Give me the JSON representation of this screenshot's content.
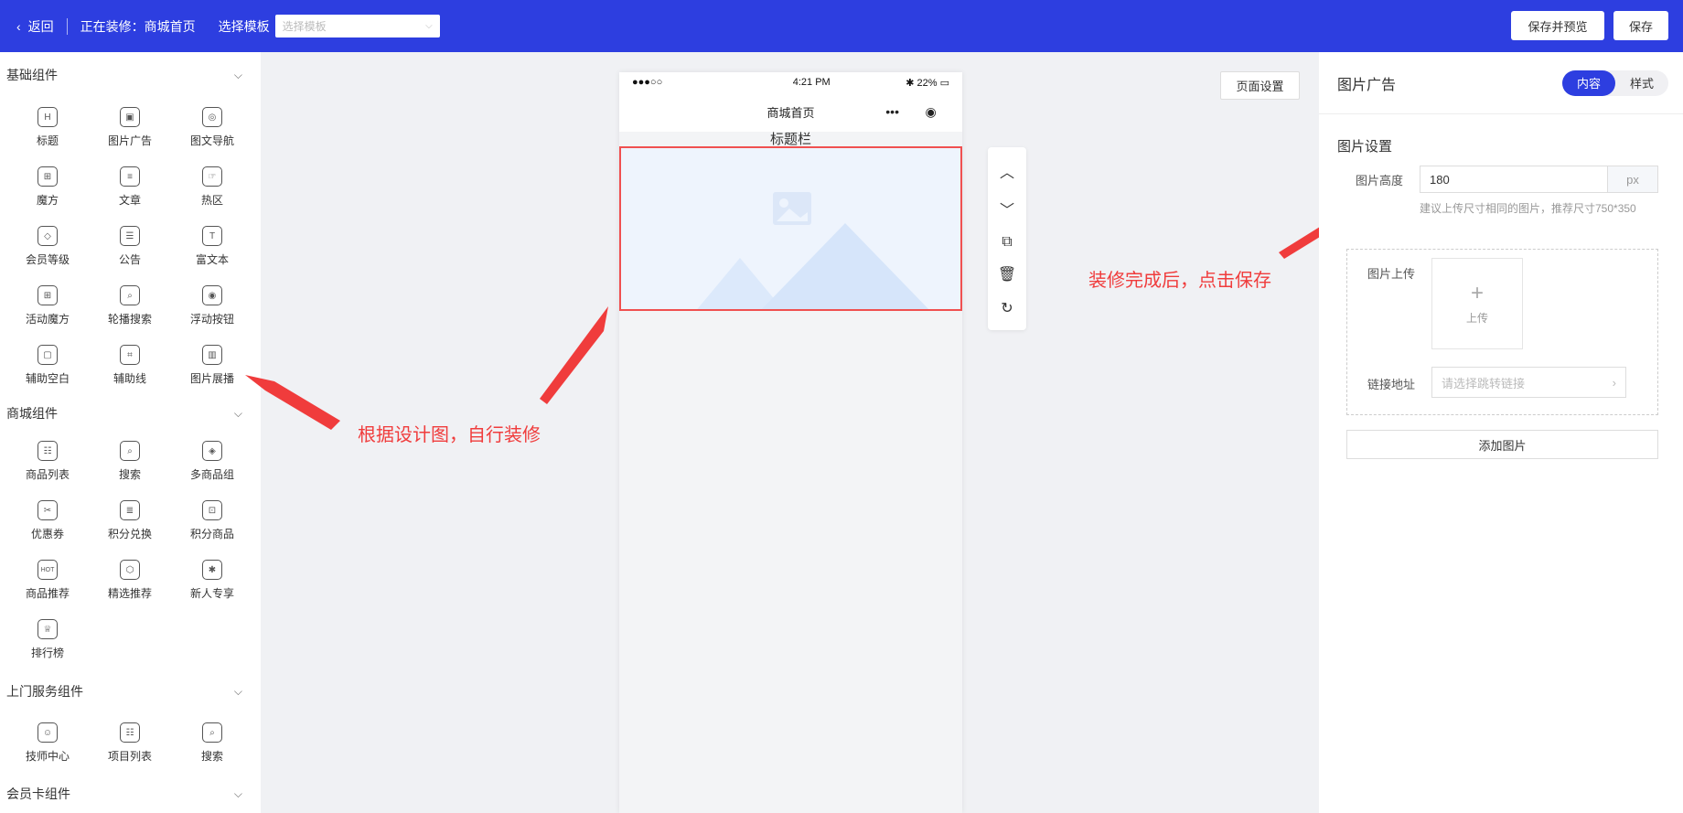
{
  "topbar": {
    "back_label": "返回",
    "editing_label": "正在装修：商城首页",
    "template_label": "选择模板",
    "template_placeholder": "选择模板",
    "save_preview_label": "保存并预览",
    "save_label": "保存",
    "bg_color": "#2d3ee0"
  },
  "left_panel": {
    "groups": [
      {
        "title": "基础组件",
        "items": [
          {
            "label": "标题",
            "icon": "H"
          },
          {
            "label": "图片广告",
            "icon": "▣"
          },
          {
            "label": "图文导航",
            "icon": "◎"
          },
          {
            "label": "魔方",
            "icon": "⊞"
          },
          {
            "label": "文章",
            "icon": "≡"
          },
          {
            "label": "热区",
            "icon": "☞"
          },
          {
            "label": "会员等级",
            "icon": "◇"
          },
          {
            "label": "公告",
            "icon": "☰"
          },
          {
            "label": "富文本",
            "icon": "T"
          },
          {
            "label": "活动魔方",
            "icon": "⊞"
          },
          {
            "label": "轮播搜索",
            "icon": "⌕"
          },
          {
            "label": "浮动按钮",
            "icon": "◉"
          },
          {
            "label": "辅助空白",
            "icon": "▢"
          },
          {
            "label": "辅助线",
            "icon": "⌗"
          },
          {
            "label": "图片展播",
            "icon": "▥"
          }
        ]
      },
      {
        "title": "商城组件",
        "items": [
          {
            "label": "商品列表",
            "icon": "☷"
          },
          {
            "label": "搜索",
            "icon": "⌕"
          },
          {
            "label": "多商品组",
            "icon": "◈"
          },
          {
            "label": "优惠券",
            "icon": "✂"
          },
          {
            "label": "积分兑换",
            "icon": "≣"
          },
          {
            "label": "积分商品",
            "icon": "⊡"
          },
          {
            "label": "商品推荐",
            "icon": "HOT"
          },
          {
            "label": "精选推荐",
            "icon": "⬡"
          },
          {
            "label": "新人专享",
            "icon": "✱"
          },
          {
            "label": "排行榜",
            "icon": "♕"
          }
        ]
      },
      {
        "title": "上门服务组件",
        "items": [
          {
            "label": "技师中心",
            "icon": "☺"
          },
          {
            "label": "项目列表",
            "icon": "☷"
          },
          {
            "label": "搜索",
            "icon": "⌕"
          }
        ]
      },
      {
        "title": "会员卡组件",
        "items": []
      }
    ]
  },
  "phone": {
    "signal": "●●●○○",
    "time": "4:21 PM",
    "battery": "22%",
    "nav_title": "商城首页",
    "title_bar_text": "标题栏"
  },
  "canvas": {
    "page_settings_label": "页面设置"
  },
  "annotations": {
    "left_note": "根据设计图，自行装修",
    "right_note": "装修完成后，点击保存",
    "color": "#f03c3c"
  },
  "right_panel": {
    "title": "图片广告",
    "tab_content": "内容",
    "tab_style": "样式",
    "section_title": "图片设置",
    "height_label": "图片高度",
    "height_value": "180",
    "height_unit": "px",
    "hint": "建议上传尺寸相同的图片，推荐尺寸750*350",
    "upload_label": "图片上传",
    "upload_button": "上传",
    "link_label": "链接地址",
    "link_placeholder": "请选择跳转链接",
    "add_image_label": "添加图片"
  }
}
